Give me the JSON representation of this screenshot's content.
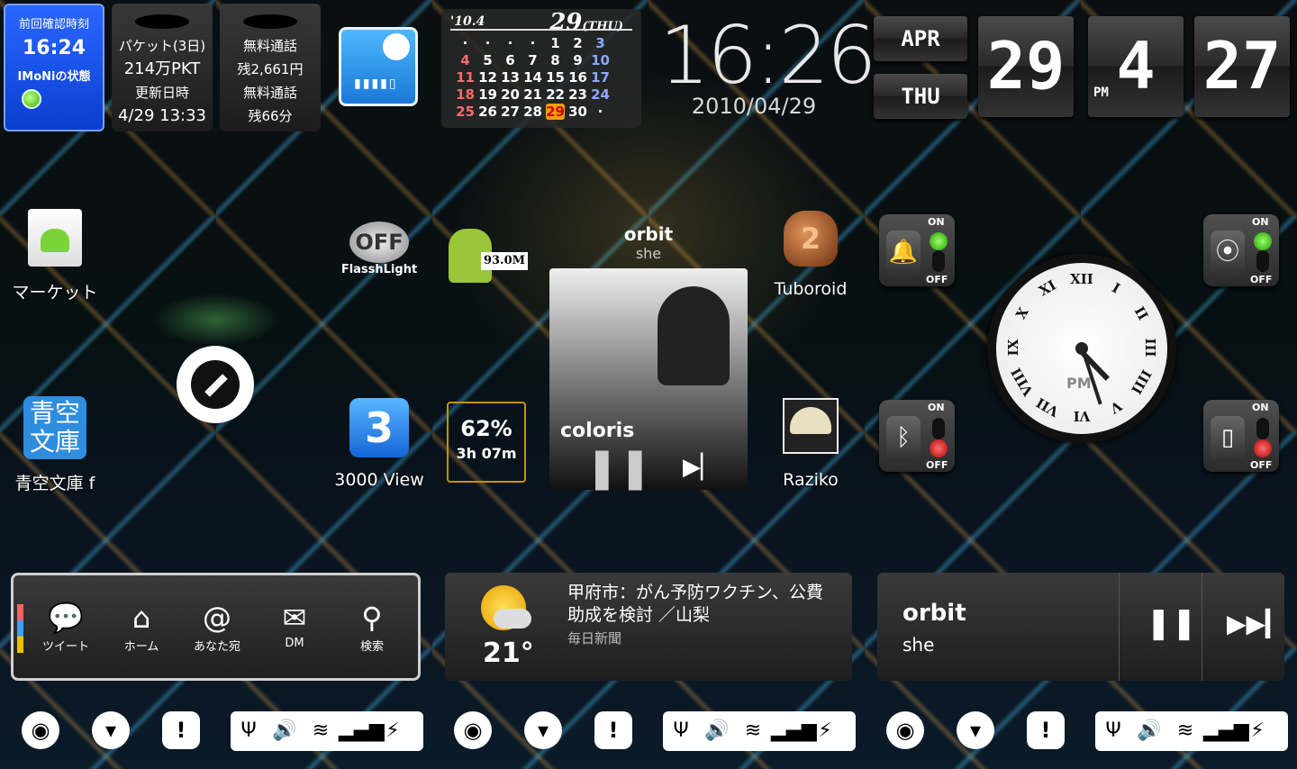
{
  "imoni": {
    "last_check_label": "前回確認時刻",
    "last_check_time": "16:24",
    "status_label": "IMoNiの状態",
    "status_color": "#36b40a"
  },
  "packet": {
    "line1": "パケット(3日)",
    "line2": "214万PKT",
    "line3": "更新日時",
    "line4": "4/29 13:33"
  },
  "free_call": {
    "line1": "無料通話",
    "line2": "残2,661円",
    "line3": "無料通話",
    "line4": "残66分"
  },
  "calendar": {
    "year": "'10.4",
    "day": "29",
    "weekday": "(THU)",
    "rows": [
      [
        "·",
        "·",
        "·",
        "·",
        "1",
        "2",
        "3"
      ],
      [
        "4",
        "5",
        "6",
        "7",
        "8",
        "9",
        "10"
      ],
      [
        "11",
        "12",
        "13",
        "14",
        "15",
        "16",
        "17"
      ],
      [
        "18",
        "19",
        "20",
        "21",
        "22",
        "23",
        "24"
      ],
      [
        "25",
        "26",
        "27",
        "28",
        "29",
        "30",
        "·"
      ]
    ],
    "today": "29"
  },
  "digital_clock": {
    "time": "16:26",
    "date": "2010/04/29"
  },
  "flip_clock": {
    "month": "APR",
    "weekday": "THU",
    "day": "29",
    "hour": "4",
    "ampm": "PM",
    "minute": "27"
  },
  "analog_clock": {
    "ampm": "PM",
    "numerals": [
      "XII",
      "I",
      "II",
      "III",
      "IIII",
      "V",
      "VI",
      "VII",
      "VIII",
      "IX",
      "X",
      "XI"
    ]
  },
  "apps": {
    "market": "マーケット",
    "flashlight_status": "OFF",
    "flashlight": "FlasshLight",
    "memory": "93.0M",
    "tuboroid": "Tuboroid",
    "tuboroid_num": "2",
    "aozora": "青空文庫 f",
    "aozora_icon": "青空文庫",
    "view3000": "3000 View",
    "view3000_num": "3",
    "raziko": "Raziko"
  },
  "battery": {
    "percent": "62%",
    "remaining": "3h 07m"
  },
  "music": {
    "title": "orbit",
    "artist": "she",
    "brand": "coloris"
  },
  "toggles": {
    "on": "ON",
    "off": "OFF"
  },
  "tweet": {
    "items": [
      "ツイート",
      "ホーム",
      "あなた宛",
      "DM",
      "検索"
    ]
  },
  "weather": {
    "temp": "21°",
    "headline": "甲府市：がん予防ワクチン、公費助成を検討 ／山梨",
    "source": "毎日新聞"
  },
  "music2": {
    "title": "orbit",
    "artist": "she"
  }
}
